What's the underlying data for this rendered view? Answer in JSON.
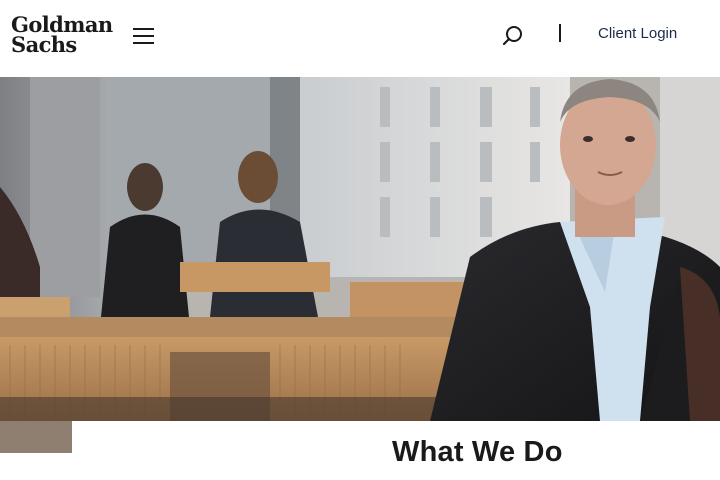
{
  "header": {
    "logo_line1": "Goldman",
    "logo_line2": "Sachs",
    "menu_icon": "hamburger-menu-icon",
    "search_icon": "search-icon",
    "client_login_label": "Client Login"
  },
  "hero": {
    "image_description_icon": "hero-photo"
  },
  "section": {
    "title": "What We Do"
  },
  "colors": {
    "text": "#1a1a1a",
    "login": "#1c2b48",
    "accent_tab": "#8e7f71"
  }
}
